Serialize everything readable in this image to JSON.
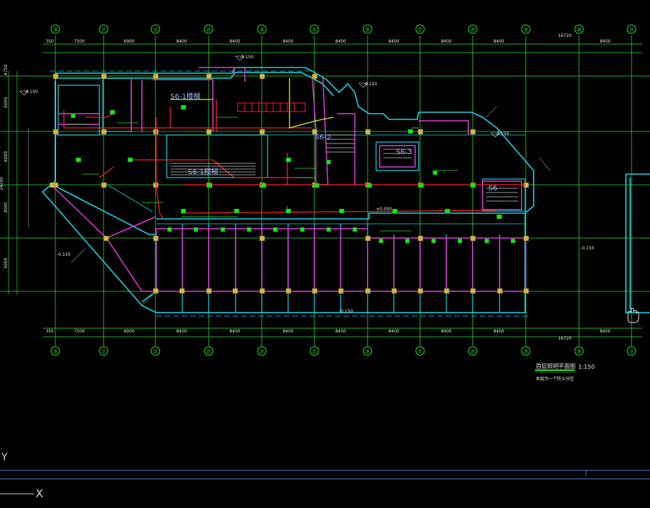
{
  "grid_bubbles": {
    "top": [
      "⑳",
      "㉑",
      "㉒",
      "㉓",
      "㉔",
      "㉕",
      "㉖",
      "㉗",
      "㉘",
      "㉙",
      "㉚",
      "㉛"
    ],
    "bottom": [
      "⑳",
      "㉑",
      "㉒",
      "㉓",
      "㉔",
      "㉕",
      "㉖",
      "㉗",
      "㉘",
      "㉙",
      "㉚",
      "㉛"
    ]
  },
  "dimensions": {
    "top": [
      "350",
      "7500",
      "6900",
      "8400",
      "8400",
      "8400",
      "8400",
      "8400",
      "8400",
      "8400",
      "8400"
    ],
    "bottom": [
      "350",
      "7500",
      "6900",
      "8400",
      "8400",
      "8400",
      "8400",
      "8400",
      "8400",
      "8400",
      "8400"
    ],
    "overall": "16720",
    "left": [
      "4750",
      "5000",
      "6000",
      "3000",
      "5000"
    ],
    "left_total": "24700"
  },
  "elevations": [
    "-0.150",
    "-0.150",
    "-0.150",
    "-0.150",
    "-0.150",
    "-0.150",
    "±0.000",
    "-0.150"
  ],
  "stair_labels": [
    "S6-1楼梯",
    "S6-2",
    "S6-3",
    "S6-1楼梯",
    "S6"
  ],
  "title_block": {
    "drawing_title": "首层照明平面图",
    "scale": "1:150",
    "subtitle": "本层为一个防火分区"
  },
  "ucs": {
    "y_axis": "Y",
    "x_axis": "X"
  }
}
